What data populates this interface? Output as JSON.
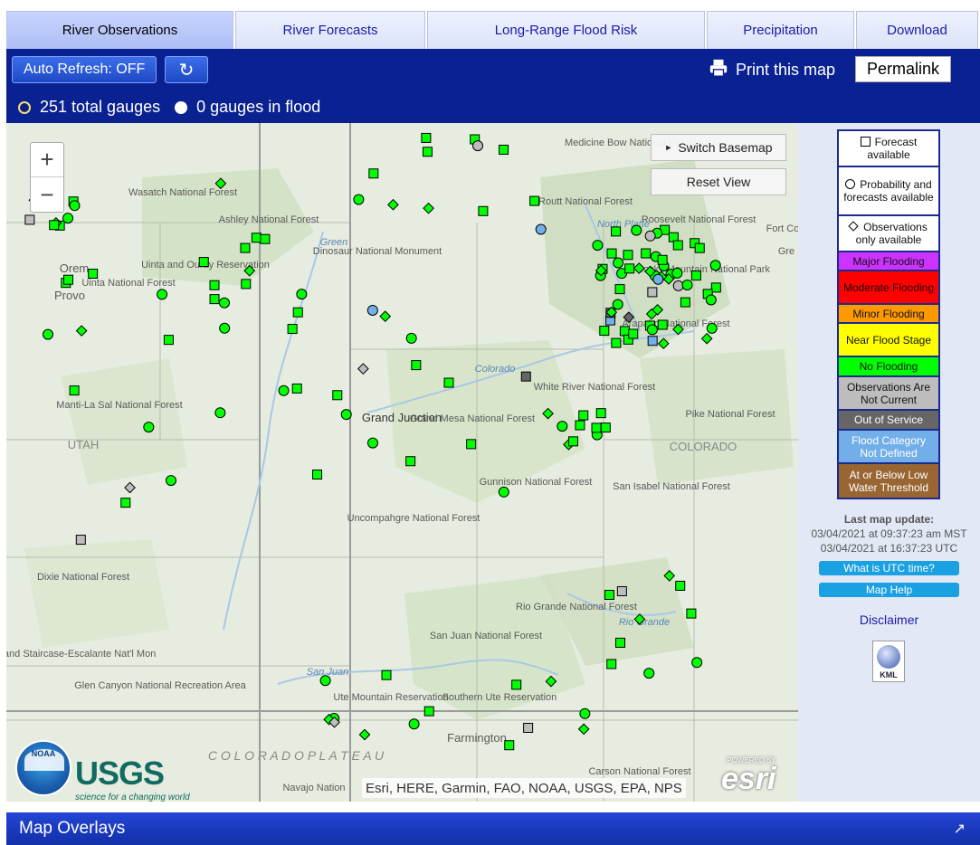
{
  "tabs": [
    {
      "label": "River Observations",
      "active": true
    },
    {
      "label": "River Forecasts",
      "active": false
    },
    {
      "label": "Long-Range Flood Risk",
      "active": false
    },
    {
      "label": "Precipitation",
      "active": false
    },
    {
      "label": "Download",
      "active": false
    }
  ],
  "toolbar": {
    "auto_refresh_label": "Auto Refresh: OFF",
    "print_label": "Print this map",
    "permalink_label": "Permalink"
  },
  "gauge_summary": {
    "total_label": "251 total gauges",
    "flood_label": "0 gauges in flood"
  },
  "map": {
    "switch_basemap_label": "Switch Basemap",
    "reset_view_label": "Reset View",
    "zoom_in": "+",
    "zoom_out": "−",
    "attribution": "Esri, HERE, Garmin, FAO, NOAA, USGS, EPA, NPS",
    "usgs_logo": "USGS",
    "usgs_tagline": "science for a changing world",
    "esri_powered_by": "POWERED BY",
    "esri_logo": "esri",
    "noaa_logo": "NOAA",
    "place_labels": [
      "Grand Junction",
      "Grand Mesa National Forest",
      "Gunnison National Forest",
      "Uncompahgre National Forest",
      "White River National Forest",
      "Dinosaur National Monument",
      "Ashley National Forest",
      "Uinta and Ouray Reservation",
      "Uinta National Forest",
      "Manti-La Sal National Forest",
      "UTAH",
      "COLORADO",
      "Dixie National Forest",
      "Grand Staircase-Escalante Nat'l Mon",
      "Glen Canyon National Recreation Area",
      "San Juan National Forest",
      "Ute Mountain Reservation",
      "Southern Ute Reservation",
      "Rio Grande National Forest",
      "Pike National Forest",
      "San Isabel National Forest",
      "Arapaho National Forest",
      "Routt National Forest",
      "Medicine Bow National Forest",
      "Roosevelt National Forest",
      "Rocky Mountain National Park",
      "Wasatch National Forest",
      "Orem",
      "Provo",
      "Farmington",
      "Navajo Nation",
      "Carson National Forest",
      "C O L O R A D O   P L A T E A U",
      "Colorado",
      "Green",
      "San Juan",
      "Rio Grande",
      "North Platte",
      "Fort Co",
      "Gre"
    ]
  },
  "legend": [
    {
      "label": "Forecast available",
      "symbol": "square",
      "color": "#ffffff"
    },
    {
      "label": "Probability and forecasts available",
      "symbol": "circle",
      "color": "#ffffff"
    },
    {
      "label": "Observations only available",
      "symbol": "diamond",
      "color": "#ffffff"
    },
    {
      "label": "Major Flooding",
      "color": "#cc33ff"
    },
    {
      "label": "Moderate Flooding",
      "color": "#ff0000"
    },
    {
      "label": "Minor Flooding",
      "color": "#ff9900"
    },
    {
      "label": "Near Flood Stage",
      "color": "#ffff00"
    },
    {
      "label": "No Flooding",
      "color": "#00ff00"
    },
    {
      "label": "Observations Are Not Current",
      "color": "#bdbdbd"
    },
    {
      "label": "Out of Service",
      "color": "#666666"
    },
    {
      "label": "Flood Category Not Defined",
      "color": "#72afe9"
    },
    {
      "label": "At or Below Low Water Threshold",
      "color": "#996633"
    }
  ],
  "update_info": {
    "heading": "Last map update:",
    "local_time": "03/04/2021 at 09:37:23 am MST",
    "utc_time": "03/04/2021 at 16:37:23 UTC"
  },
  "side_links": {
    "utc_help": "What is UTC time?",
    "map_help": "Map Help",
    "disclaimer": "Disclaimer",
    "kml": "KML"
  },
  "footer": {
    "map_overlays_label": "Map Overlays"
  },
  "colors": {
    "header_band": "#0a2191",
    "no_flooding": "#00ff00",
    "not_current": "#bdbdbd",
    "out_of_service": "#666666",
    "not_defined": "#72afe9"
  }
}
